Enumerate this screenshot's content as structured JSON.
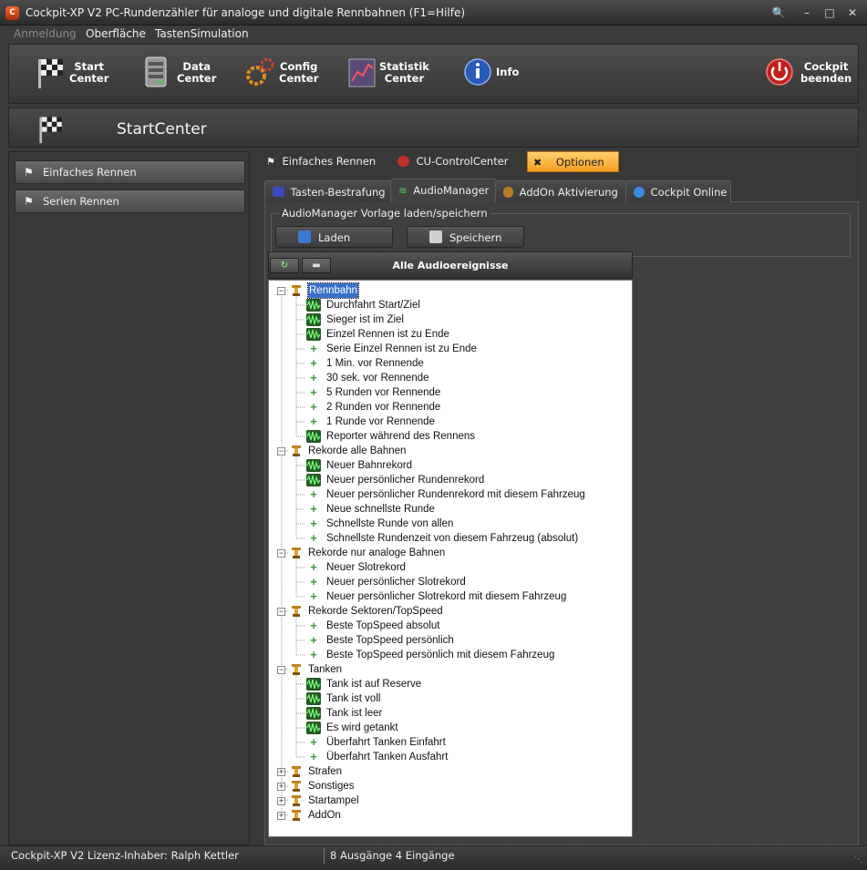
{
  "window": {
    "title": "Cockpit-XP V2 PC-Rundenzähler für analoge und digitale Rennbahnen (F1=Hilfe)",
    "icon_name": "cockpit-app-icon"
  },
  "menu": {
    "items": [
      {
        "label": "Anmeldung",
        "disabled": true
      },
      {
        "label": "Oberfläche",
        "disabled": false
      },
      {
        "label": "TastenSimulation",
        "disabled": false
      }
    ]
  },
  "toolbar": {
    "start": "Start\nCenter",
    "data": "Data\nCenter",
    "config": "Config\nCenter",
    "statistik": "Statistik\nCenter",
    "info": "Info",
    "exit": "Cockpit\nbeenden"
  },
  "section": {
    "title": "StartCenter"
  },
  "sidebar": {
    "items": [
      {
        "label": "Einfaches Rennen",
        "icon": "flag-icon"
      },
      {
        "label": "Serien Rennen",
        "icon": "flags-icon"
      }
    ]
  },
  "top_tabs": [
    {
      "label": "Einfaches Rennen",
      "active": false
    },
    {
      "label": "CU-ControlCenter",
      "active": false
    },
    {
      "label": "Optionen",
      "active": true
    }
  ],
  "sub_tabs": [
    {
      "label": "Tasten-Bestrafung",
      "active": false
    },
    {
      "label": "AudioManager",
      "active": true
    },
    {
      "label": "AddOn Aktivierung",
      "active": false
    },
    {
      "label": "Cockpit Online",
      "active": false
    }
  ],
  "audio_manager": {
    "group_title": "AudioManager Vorlage laden/speichern",
    "load_button": "Laden",
    "save_button": "Speichern",
    "tree_title": "Alle Audioereignisse"
  },
  "tree": [
    {
      "label": "Rennbahn",
      "expanded": true,
      "selected": true,
      "children": [
        {
          "label": "Durchfahrt Start/Ziel",
          "type": "wave"
        },
        {
          "label": "Sieger ist im Ziel",
          "type": "wave"
        },
        {
          "label": "Einzel Rennen ist zu Ende",
          "type": "wave"
        },
        {
          "label": "Serie Einzel Rennen ist zu Ende",
          "type": "plus"
        },
        {
          "label": "1 Min. vor Rennende",
          "type": "plus"
        },
        {
          "label": "30 sek. vor Rennende",
          "type": "plus"
        },
        {
          "label": "5 Runden vor Rennende",
          "type": "plus"
        },
        {
          "label": "2 Runden vor Rennende",
          "type": "plus"
        },
        {
          "label": "1 Runde vor Rennende",
          "type": "plus"
        },
        {
          "label": "Reporter während des Rennens",
          "type": "wave"
        }
      ]
    },
    {
      "label": "Rekorde alle Bahnen",
      "expanded": true,
      "children": [
        {
          "label": "Neuer Bahnrekord",
          "type": "wave"
        },
        {
          "label": "Neuer persönlicher Rundenrekord",
          "type": "wave"
        },
        {
          "label": "Neuer persönlicher Rundenrekord mit diesem Fahrzeug",
          "type": "plus"
        },
        {
          "label": "Neue schnellste Runde",
          "type": "plus"
        },
        {
          "label": "Schnellste Runde von allen",
          "type": "plus"
        },
        {
          "label": "Schnellste Rundenzeit von diesem Fahrzeug (absolut)",
          "type": "plus"
        }
      ]
    },
    {
      "label": "Rekorde nur analoge Bahnen",
      "expanded": true,
      "children": [
        {
          "label": "Neuer Slotrekord",
          "type": "plus"
        },
        {
          "label": "Neuer persönlicher Slotrekord",
          "type": "plus"
        },
        {
          "label": "Neuer persönlicher Slotrekord mit diesem Fahrzeug",
          "type": "plus"
        }
      ]
    },
    {
      "label": "Rekorde Sektoren/TopSpeed",
      "expanded": true,
      "children": [
        {
          "label": "Beste TopSpeed absolut",
          "type": "plus"
        },
        {
          "label": "Beste TopSpeed persönlich",
          "type": "plus"
        },
        {
          "label": "Beste TopSpeed persönlich mit diesem Fahrzeug",
          "type": "plus"
        }
      ]
    },
    {
      "label": "Tanken",
      "expanded": true,
      "children": [
        {
          "label": "Tank ist auf Reserve",
          "type": "wave"
        },
        {
          "label": "Tank ist voll",
          "type": "wave"
        },
        {
          "label": "Tank ist leer",
          "type": "wave"
        },
        {
          "label": "Es wird getankt",
          "type": "wave"
        },
        {
          "label": "Überfahrt Tanken Einfahrt",
          "type": "plus"
        },
        {
          "label": "Überfahrt Tanken Ausfahrt",
          "type": "plus"
        }
      ]
    },
    {
      "label": "Strafen",
      "expanded": false,
      "children": []
    },
    {
      "label": "Sonstiges",
      "expanded": false,
      "children": []
    },
    {
      "label": "Startampel",
      "expanded": false,
      "children": []
    },
    {
      "label": "AddOn",
      "expanded": false,
      "children": []
    }
  ],
  "status": {
    "license": "Cockpit-XP V2 Lizenz-Inhaber: Ralph Kettler",
    "io": "8 Ausgänge 4 Eingänge"
  }
}
